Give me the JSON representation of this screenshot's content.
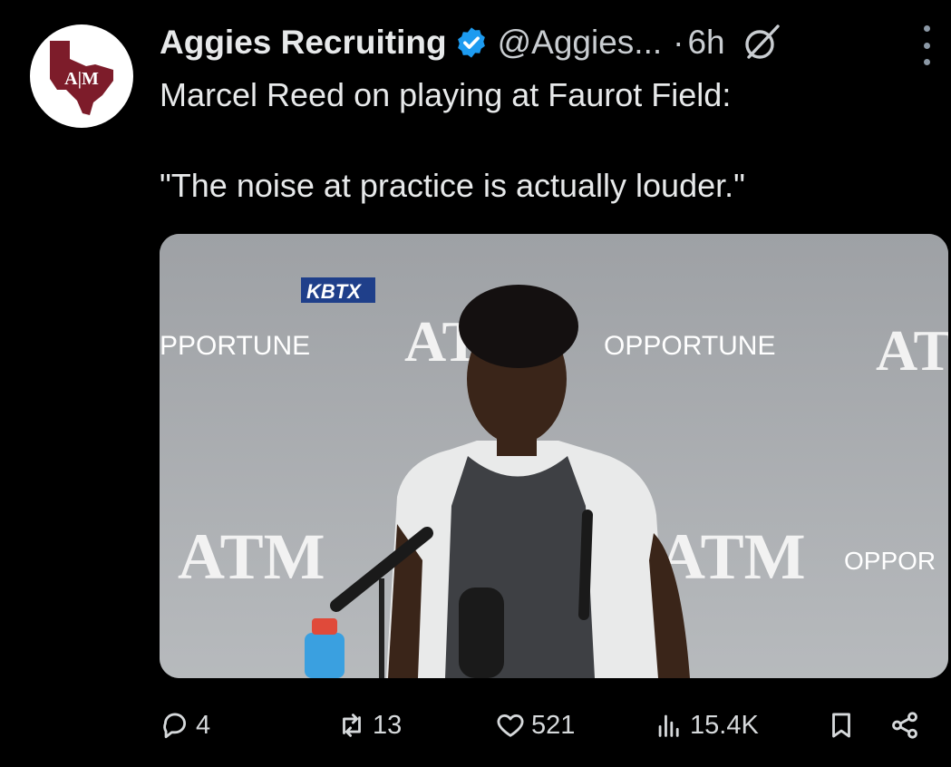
{
  "account": {
    "name": "Aggies Recruiting",
    "handle": "@Aggies...",
    "separator": "·",
    "time": "6h",
    "verified": true,
    "avatar_logo_text": "ATM"
  },
  "tweet": {
    "line1": "Marcel Reed on playing at Faurot Field:",
    "line2": "\"The noise at practice is actually louder.\""
  },
  "media": {
    "watermark": "KBTX",
    "backdrop_texts": [
      "PPORTUNE",
      "OPPORTUNE",
      "OPPOR"
    ],
    "logo_text": "ATM"
  },
  "actions": {
    "replies": "4",
    "reposts": "13",
    "likes": "521",
    "views": "15.4K"
  },
  "colors": {
    "background": "#000000",
    "text": "#e7e9ea",
    "secondary": "#c9cdd1",
    "verified": "#1d9bf0",
    "maroon": "#7d1c2a"
  }
}
